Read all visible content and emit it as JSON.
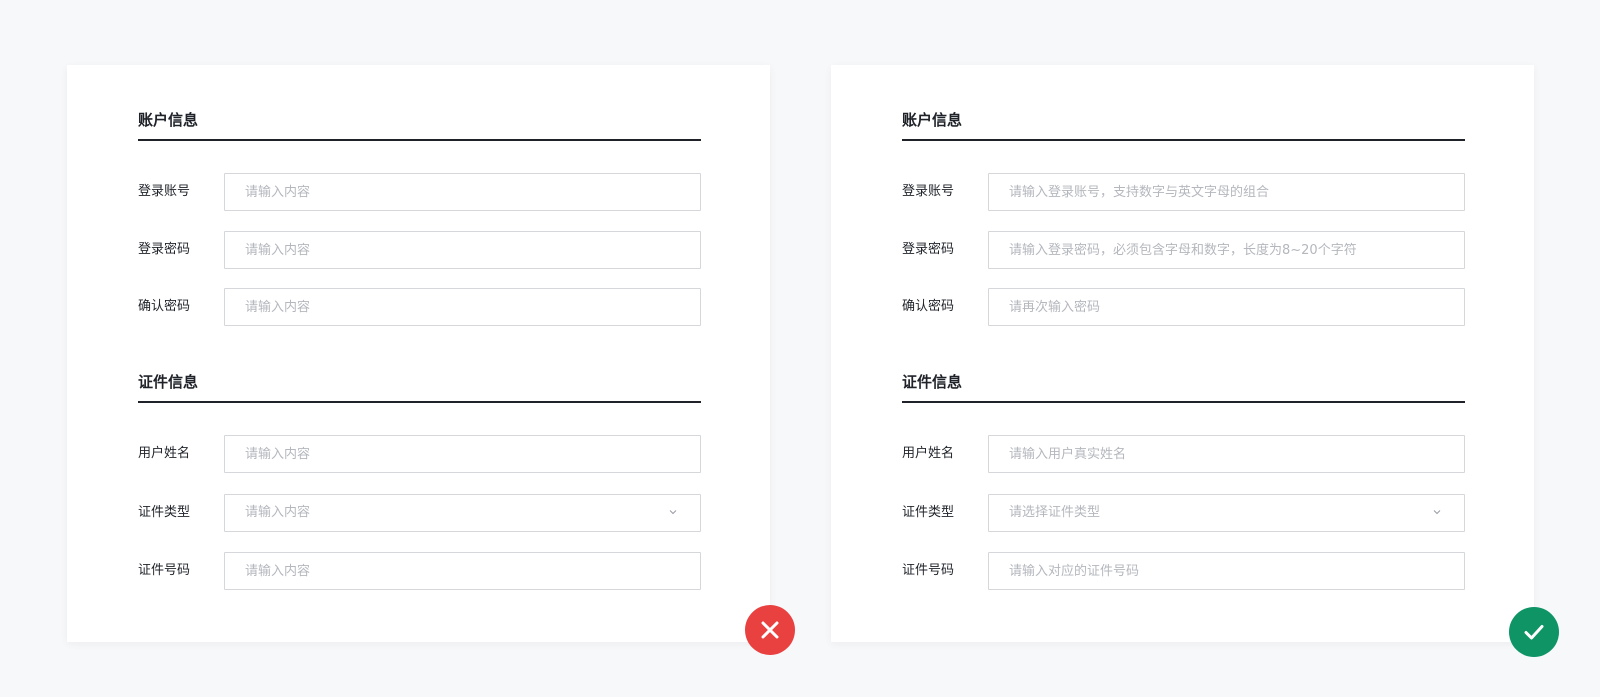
{
  "colors": {
    "page_background": "#f7f8fa",
    "card_background": "#ffffff",
    "heading_text": "#1f2329",
    "placeholder_text": "#b4b7bd",
    "input_border": "#d5d7db",
    "wrong_badge": "#e94040",
    "right_badge": "#0f9466"
  },
  "wrong_example": {
    "badge_icon": "close-icon",
    "account_section": {
      "title": "账户信息",
      "login_account": {
        "label": "登录账号",
        "placeholder": "请输入内容"
      },
      "login_password": {
        "label": "登录密码",
        "placeholder": "请输入内容"
      },
      "confirm_password": {
        "label": "确认密码",
        "placeholder": "请输入内容"
      }
    },
    "certificate_section": {
      "title": "证件信息",
      "user_name": {
        "label": "用户姓名",
        "placeholder": "请输入内容"
      },
      "certificate_type": {
        "label": "证件类型",
        "placeholder": "请输入内容",
        "icon": "chevron-down-icon"
      },
      "certificate_number": {
        "label": "证件号码",
        "placeholder": "请输入内容"
      }
    }
  },
  "right_example": {
    "badge_icon": "check-icon",
    "account_section": {
      "title": "账户信息",
      "login_account": {
        "label": "登录账号",
        "placeholder": "请输入登录账号，支持数字与英文字母的组合"
      },
      "login_password": {
        "label": "登录密码",
        "placeholder": "请输入登录密码，必须包含字母和数字，长度为8~20个字符"
      },
      "confirm_password": {
        "label": "确认密码",
        "placeholder": "请再次输入密码"
      }
    },
    "certificate_section": {
      "title": "证件信息",
      "user_name": {
        "label": "用户姓名",
        "placeholder": "请输入用户真实姓名"
      },
      "certificate_type": {
        "label": "证件类型",
        "placeholder": "请选择证件类型",
        "icon": "chevron-down-icon"
      },
      "certificate_number": {
        "label": "证件号码",
        "placeholder": "请输入对应的证件号码"
      }
    }
  }
}
